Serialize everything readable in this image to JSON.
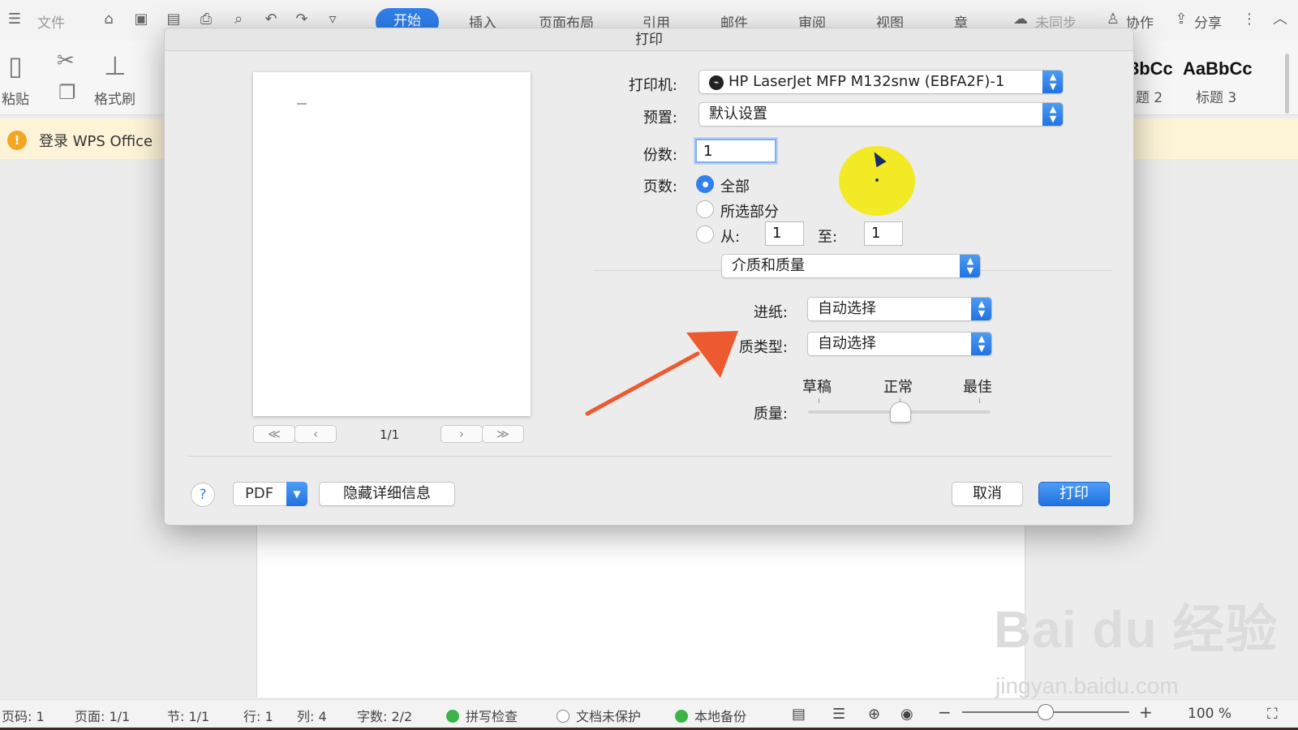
{
  "wps": {
    "menu": {
      "file": "文件",
      "tabs": [
        "开始",
        "插入",
        "页面布局",
        "引用",
        "邮件",
        "审阅",
        "视图",
        "章"
      ],
      "sync": "未同步",
      "collab": "协作",
      "share": "分享"
    },
    "ribbon": {
      "paste": "粘贴",
      "format_painter": "格式刷",
      "style_preview_1": "3bCc",
      "style_preview_2": "AaBbCc",
      "heading_2": "题 2",
      "heading_3": "标题 3"
    },
    "notice": "登录 WPS Office",
    "status": {
      "page_code": "页码: 1",
      "page": "页面: 1/1",
      "section": "节: 1/1",
      "row": "行: 1",
      "col": "列: 4",
      "words": "字数: 2/2",
      "spell_check": "拼写检查",
      "unprotected": "文档未保护",
      "backup": "本地备份",
      "zoom": "100 %"
    }
  },
  "print_dialog": {
    "title": "打印",
    "page_counter": "1/1",
    "printer_label": "打印机:",
    "printer_value": "HP LaserJet MFP M132snw (EBFA2F)-1",
    "preset_label": "预置:",
    "preset_value": "默认设置",
    "copies_label": "份数:",
    "copies_value": "1",
    "pages_label": "页数:",
    "pages_all": "全部",
    "pages_selection": "所选部分",
    "pages_from": "从:",
    "pages_from_value": "1",
    "pages_to": "至:",
    "pages_to_value": "1",
    "section_select": "介质和质量",
    "feed_label": "进纸:",
    "feed_value": "自动选择",
    "type_label": "质类型:",
    "type_value": "自动选择",
    "quality_label": "质量:",
    "quality_draft": "草稿",
    "quality_normal": "正常",
    "quality_best": "最佳",
    "quality_level": 0.5,
    "help": "?",
    "pdf": "PDF",
    "hide_details": "隐藏详细信息",
    "cancel": "取消",
    "print": "打印"
  },
  "watermark": {
    "brand": "Bai du 经验",
    "url": "jingyan.baidu.com"
  },
  "colors": {
    "accent": "#2f80ed",
    "highlight": "#f2ea1a",
    "arrow": "#ee5a30",
    "notice_bg": "#fdf4d8"
  }
}
